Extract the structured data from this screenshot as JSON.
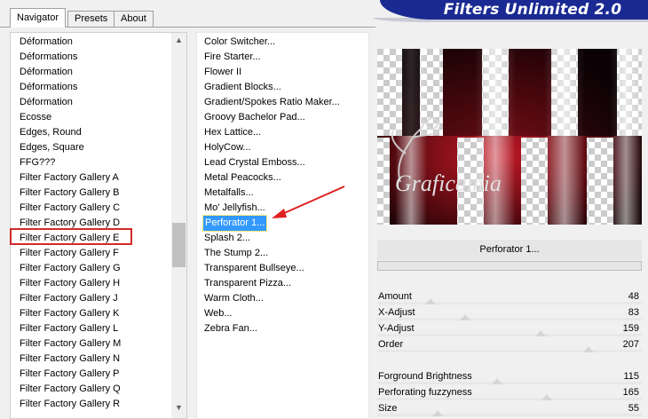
{
  "tabs": [
    {
      "label": "Navigator",
      "active": true
    },
    {
      "label": "Presets",
      "active": false
    },
    {
      "label": "About",
      "active": false
    }
  ],
  "title": "Filters Unlimited 2.0",
  "categories": [
    "Déformation",
    "Déformations",
    "Déformation",
    "Déformations",
    "Déformation",
    "Ecosse",
    "Edges, Round",
    "Edges, Square",
    "FFG???",
    "Filter Factory Gallery A",
    "Filter Factory Gallery B",
    "Filter Factory Gallery C",
    "Filter Factory Gallery D",
    "Filter Factory Gallery E",
    "Filter Factory Gallery F",
    "Filter Factory Gallery G",
    "Filter Factory Gallery H",
    "Filter Factory Gallery J",
    "Filter Factory Gallery K",
    "Filter Factory Gallery L",
    "Filter Factory Gallery M",
    "Filter Factory Gallery N",
    "Filter Factory Gallery P",
    "Filter Factory Gallery Q",
    "Filter Factory Gallery R"
  ],
  "selected_category": "Filter Factory Gallery E",
  "filters": [
    "Color Switcher...",
    "Fire Starter...",
    "Flower II",
    "Gradient Blocks...",
    "Gradient/Spokes Ratio Maker...",
    "Groovy Bachelor Pad...",
    "Hex Lattice...",
    "HolyCow...",
    "Lead Crystal Emboss...",
    "Metal Peacocks...",
    "Metalfalls...",
    "Mo' Jellyfish...",
    "Perforator 1...",
    "Splash 2...",
    "The Stump 2...",
    "Transparent Bullseye...",
    "Transparent Pizza...",
    "Warm Cloth...",
    "Web...",
    "Zebra Fan..."
  ],
  "selected_filter_index": 12,
  "preview": {
    "watermark": "Graficamia"
  },
  "filter_name": "Perforator 1...",
  "params": [
    {
      "label": "Amount",
      "value": "48",
      "level": 0.188
    },
    {
      "label": "X-Adjust",
      "value": "83",
      "level": 0.325
    },
    {
      "label": "Y-Adjust",
      "value": "159",
      "level": 0.624
    },
    {
      "label": "Order",
      "value": "207",
      "level": 0.812
    },
    {
      "label": "Forground Brightness",
      "value": "115",
      "level": 0.451
    },
    {
      "label": "Perforating fuzzyness",
      "value": "165",
      "level": 0.647
    },
    {
      "label": "Size",
      "value": "55",
      "level": 0.216
    }
  ],
  "colors": {
    "title_bar": "#1a2a92",
    "selection": "#3399ff",
    "highlight_box": "#d22a2a",
    "arrow": "#e02020"
  },
  "icons": {
    "scroll_up": "chevron-up-icon",
    "scroll_down": "chevron-down-icon"
  }
}
